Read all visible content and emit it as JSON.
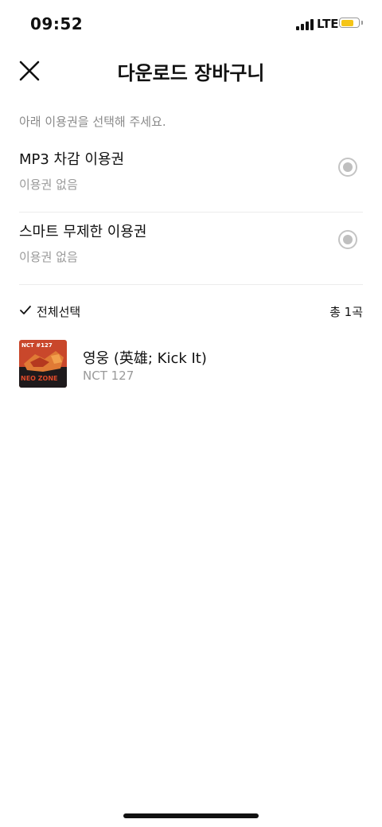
{
  "status_bar": {
    "time": "09:52",
    "network": "LTE",
    "battery_color": "#f5c518",
    "battery_level": 0.75
  },
  "header": {
    "title": "다운로드 장바구니",
    "close_icon": "close-icon"
  },
  "pass_section": {
    "hint": "아래 이용권을 선택해 주세요.",
    "passes": [
      {
        "name": "MP3 차감 이용권",
        "status": "이용권 없음"
      },
      {
        "name": "스마트 무제한 이용권",
        "status": "이용권 없음"
      }
    ]
  },
  "list_header": {
    "select_all_label": "전체선택",
    "total": "총 1곡"
  },
  "songs": [
    {
      "title": "영웅 (英雄; Kick It)",
      "artist": "NCT 127",
      "album_art_text_top": "NCT #127",
      "album_art_text_bottom": "NEO ZONE"
    }
  ]
}
